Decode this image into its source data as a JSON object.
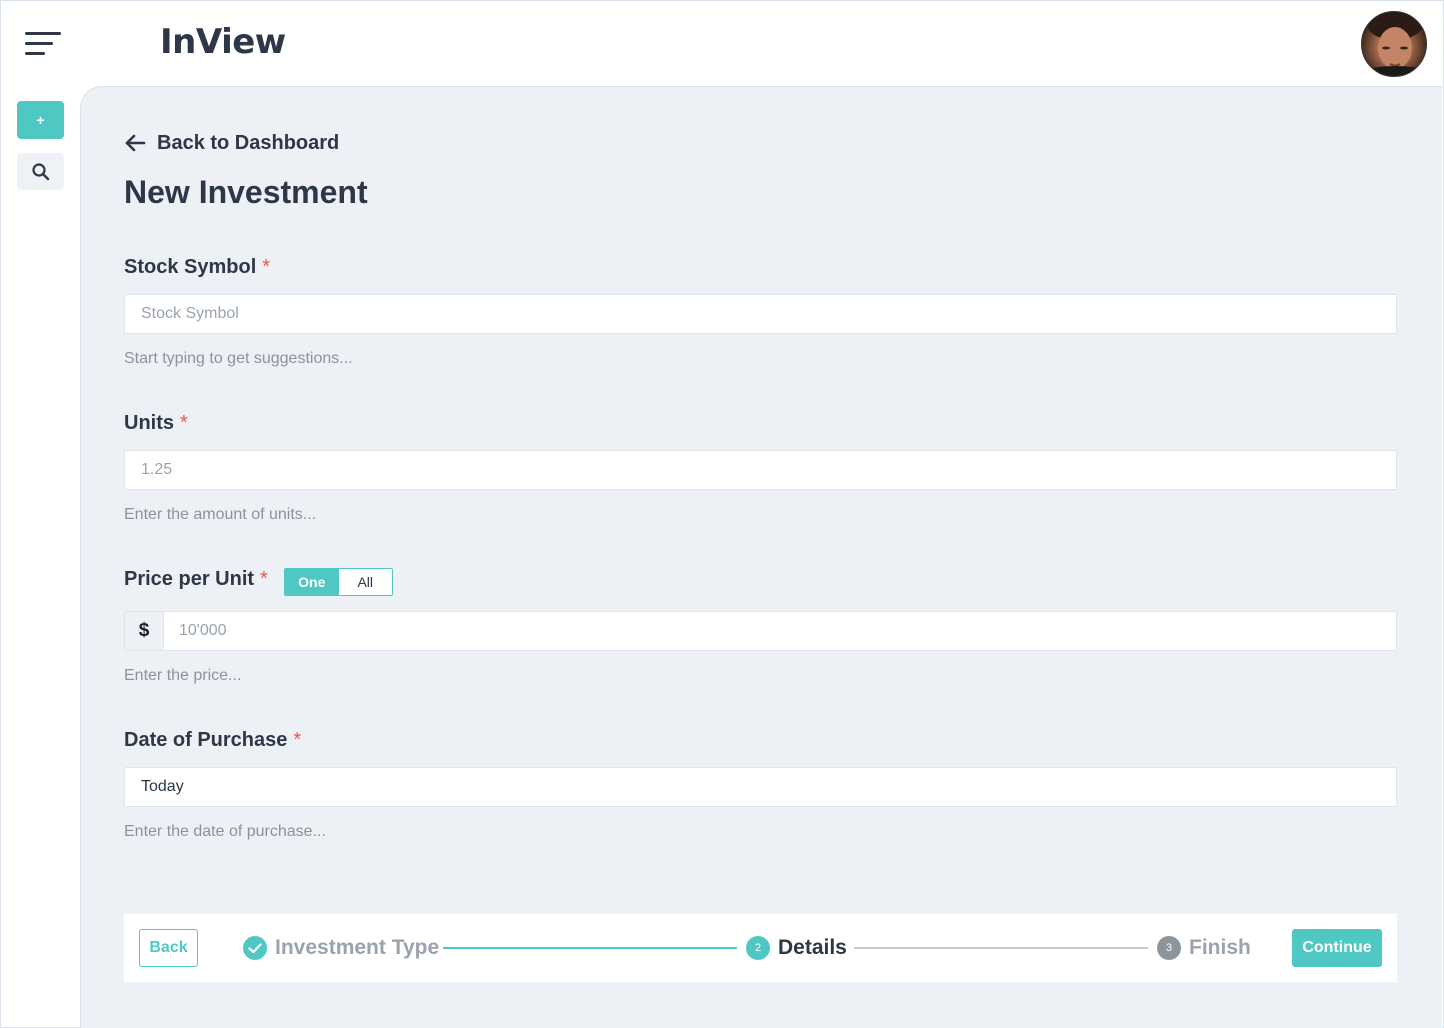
{
  "app": {
    "logo": "InView"
  },
  "sidebar": {
    "add_label": "+"
  },
  "nav": {
    "back_label": "Back to Dashboard"
  },
  "page": {
    "title": "New Investment"
  },
  "form": {
    "stock_symbol": {
      "label": "Stock Symbol",
      "required": "*",
      "placeholder": "Stock Symbol",
      "help": "Start typing to get suggestions..."
    },
    "units": {
      "label": "Units",
      "required": "*",
      "value": "1.25",
      "help": "Enter the amount of units..."
    },
    "price": {
      "label": "Price per Unit",
      "required": "*",
      "toggle_one": "One",
      "toggle_all": "All",
      "currency": "$",
      "value": "10'000",
      "help": "Enter the price..."
    },
    "date": {
      "label": "Date of Purchase",
      "required": "*",
      "value": "Today",
      "help": "Enter the date of purchase..."
    }
  },
  "stepper": {
    "back_label": "Back",
    "continue_label": "Continue",
    "steps": [
      {
        "label": "Investment Type",
        "state": "done"
      },
      {
        "number": "2",
        "label": "Details",
        "state": "active"
      },
      {
        "number": "3",
        "label": "Finish",
        "state": "pending"
      }
    ]
  },
  "colors": {
    "accent": "#4fc8c4",
    "text": "#2d3748",
    "required": "#e8574e",
    "background": "#edf1f5",
    "muted": "#8a939d",
    "step_pending": "#9aa3ad"
  }
}
